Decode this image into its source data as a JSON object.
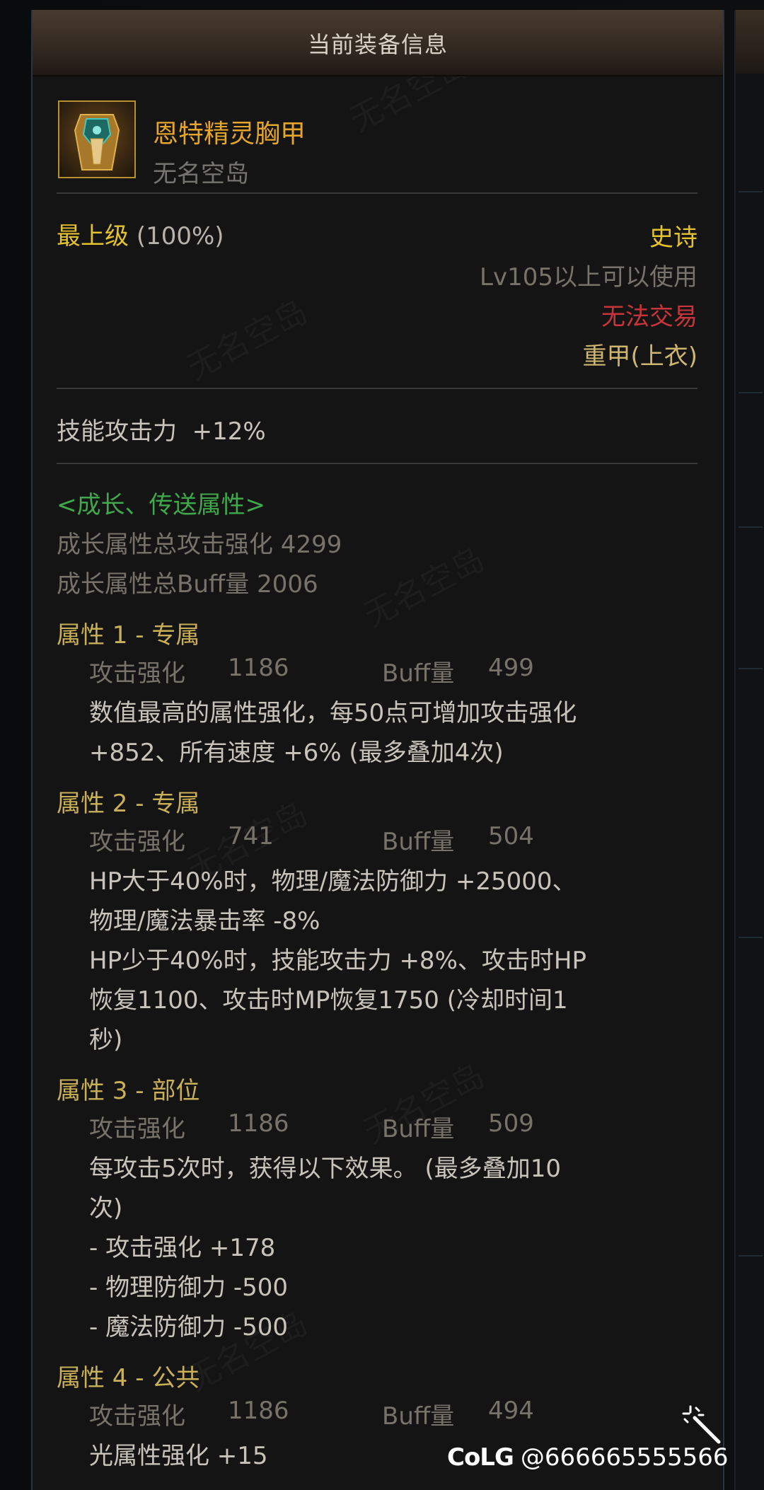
{
  "header": {
    "title": "当前装备信息"
  },
  "item": {
    "name": "恩特精灵胸甲",
    "source": "无名空岛",
    "grade": "最上级",
    "grade_pct": "(100%)",
    "rarity": "史诗",
    "level_req": "Lv105以上可以使用",
    "trade": "无法交易",
    "slot": "重甲(上衣)",
    "base_stat": {
      "name": "技能攻击力",
      "value": "+12%"
    }
  },
  "growth": {
    "section_title": "<成长、传送属性>",
    "total_attack": "成长属性总攻击强化 4299",
    "total_buff": "成长属性总Buff量 2006"
  },
  "attributes": [
    {
      "header": "属性 1 - 专属",
      "atk_label": "攻击强化",
      "atk_value": "1186",
      "buff_label": "Buff量",
      "buff_value": "499",
      "lines": [
        "数值最高的属性强化，每50点可增加攻击强化",
        "+852、所有速度 +6% (最多叠加4次)"
      ]
    },
    {
      "header": "属性 2 - 专属",
      "atk_label": "攻击强化",
      "atk_value": "741",
      "buff_label": "Buff量",
      "buff_value": "504",
      "lines": [
        "HP大于40%时，物理/魔法防御力 +25000、",
        "物理/魔法暴击率 -8%",
        "HP少于40%时，技能攻击力 +8%、攻击时HP",
        "恢复1100、攻击时MP恢复1750 (冷却时间1",
        "秒)"
      ]
    },
    {
      "header": "属性 3 - 部位",
      "atk_label": "攻击强化",
      "atk_value": "1186",
      "buff_label": "Buff量",
      "buff_value": "509",
      "lines": [
        "每攻击5次时，获得以下效果。 (最多叠加10",
        "次)",
        "- 攻击强化 +178",
        "- 物理防御力 -500",
        "- 魔法防御力 -500"
      ]
    },
    {
      "header": "属性 4 - 公共",
      "atk_label": "攻击强化",
      "atk_value": "1186",
      "buff_label": "Buff量",
      "buff_value": "494",
      "lines": [
        "光属性强化 +15"
      ]
    }
  ],
  "footer": {
    "logo": "CoLG",
    "handle": "@666665555566"
  },
  "watermark": "无名空岛"
}
